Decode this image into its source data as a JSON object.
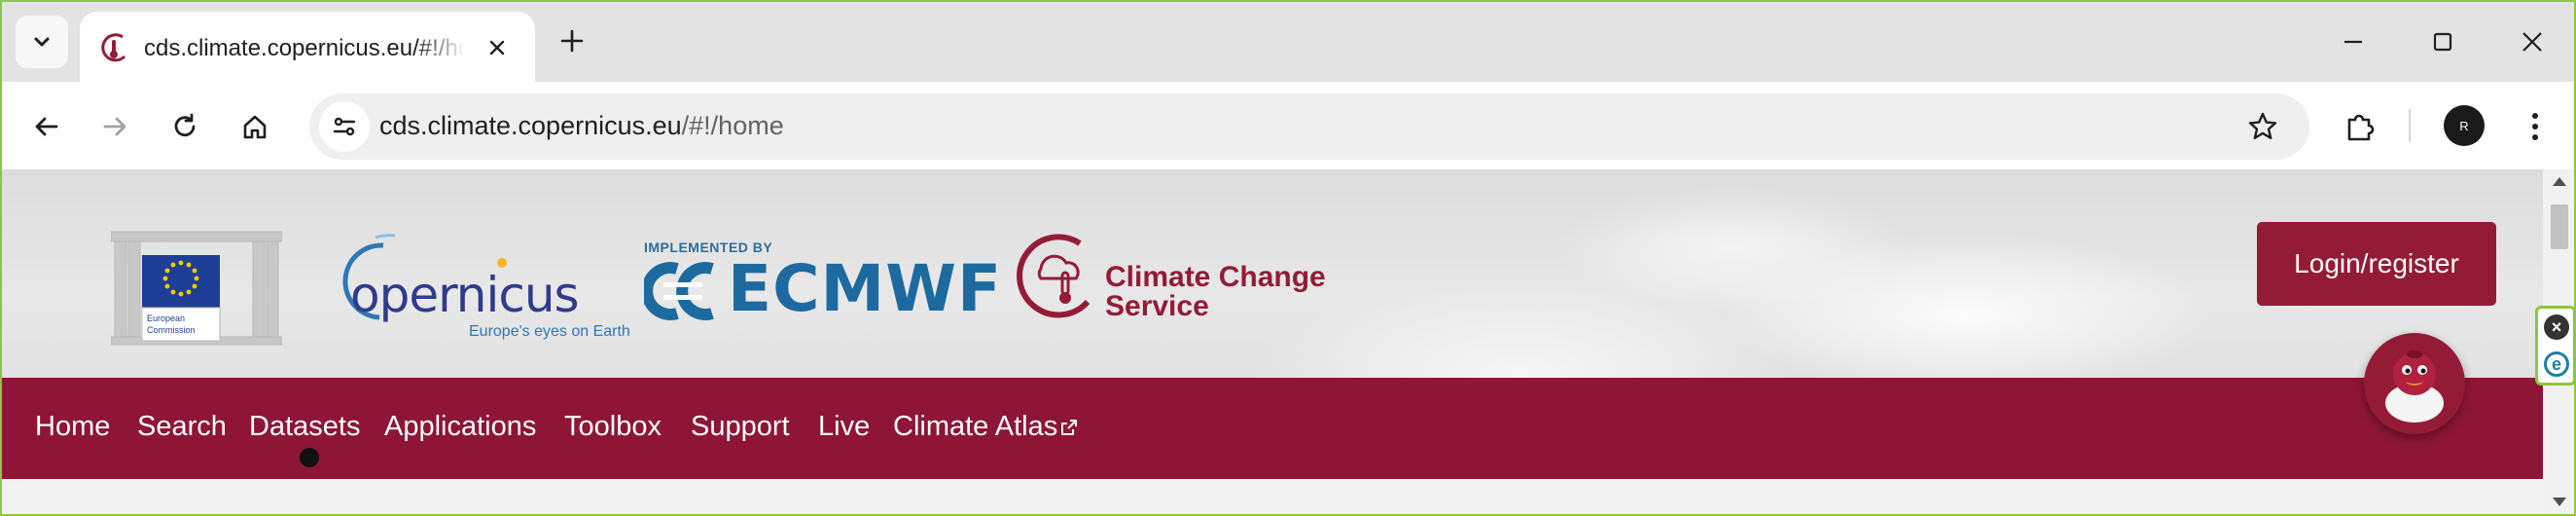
{
  "browser": {
    "tab": {
      "title": "cds.climate.copernicus.eu/#!/home"
    },
    "address_bar": {
      "url_host": "cds.climate.copernicus.eu",
      "url_path": "/#!/home"
    },
    "profile_initial": "R"
  },
  "header": {
    "eu_caption": [
      "European",
      "Commission"
    ],
    "copernicus_word": "opernicus",
    "copernicus_tagline": "Europe's eyes on Earth",
    "ecmwf_implemented": "IMPLEMENTED BY",
    "ecmwf_word": "ECMWF",
    "c3s_line1": "Climate Change",
    "c3s_line2": "Service",
    "login_label": "Login/register"
  },
  "nav": {
    "items": [
      "Home",
      "Search",
      "Datasets",
      "Applications",
      "Toolbox",
      "Support",
      "Live",
      "Climate Atlas"
    ]
  },
  "colors": {
    "brand": "#8e1536",
    "login": "#941b36",
    "window_border": "#8dc63f"
  },
  "icons": [
    "chevron-down-icon",
    "favicon-c3s-icon",
    "close-icon",
    "plus-icon",
    "minimize-icon",
    "maximize-icon",
    "back-icon",
    "forward-icon",
    "reload-icon",
    "home-icon",
    "site-info-icon",
    "star-icon",
    "extensions-icon",
    "kebab-menu-icon",
    "external-link-icon"
  ]
}
